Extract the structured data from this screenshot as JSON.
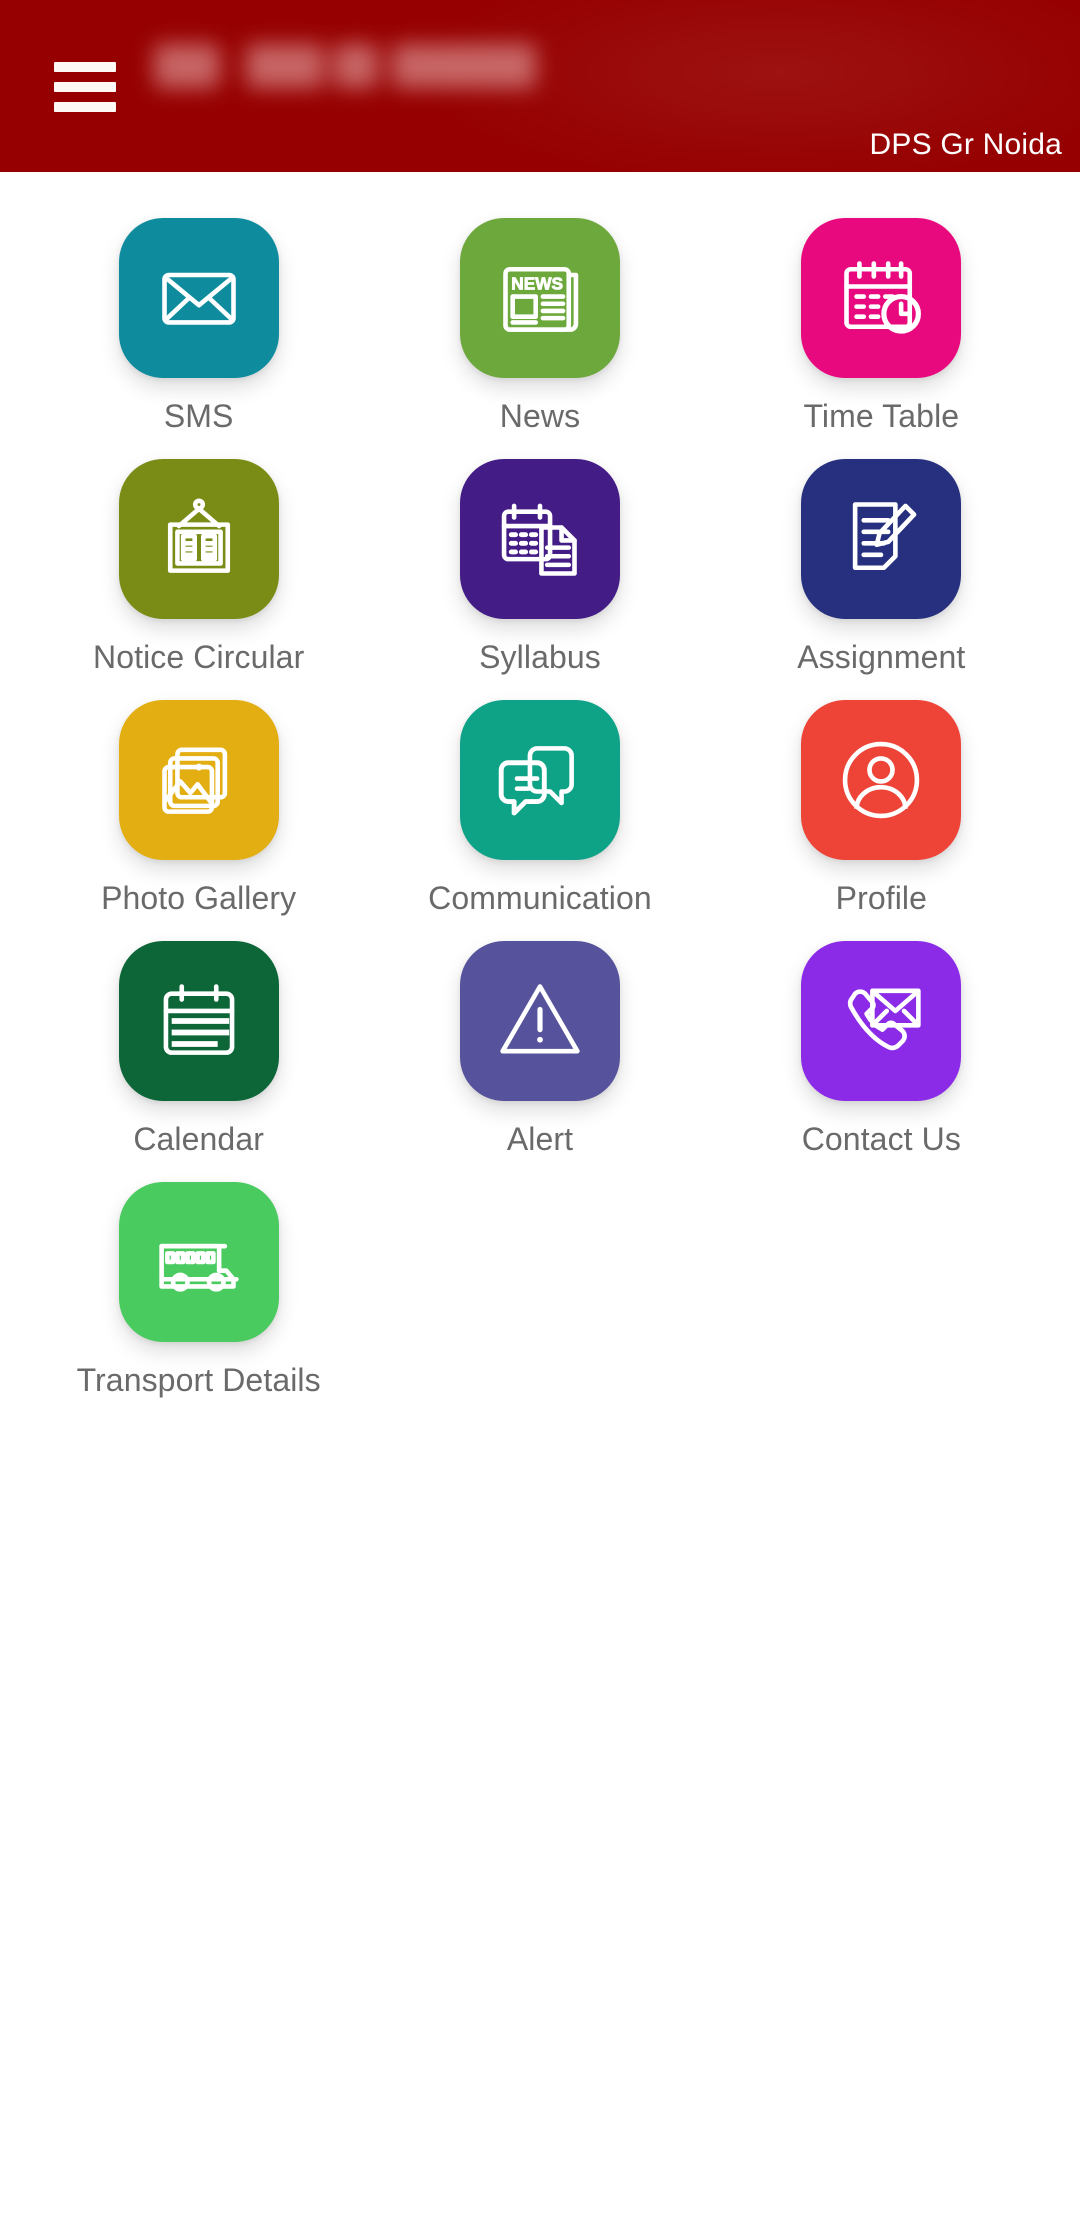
{
  "header": {
    "menu_icon": "hamburger-menu-icon",
    "title_redacted": true,
    "school_name": "DPS Gr Noida",
    "background_color": "#960000",
    "text_color": "#ffffff"
  },
  "grid": {
    "label_color": "#6a6a6a",
    "tiles": [
      {
        "label": "SMS",
        "icon": "envelope-icon",
        "color": "#0E8C9E"
      },
      {
        "label": "News",
        "icon": "newspaper-icon",
        "color": "#6DA83C"
      },
      {
        "label": "Time Table",
        "icon": "calendar-clock-icon",
        "color": "#E8097F"
      },
      {
        "label": "Notice Circular",
        "icon": "notice-board-icon",
        "color": "#7B8C16"
      },
      {
        "label": "Syllabus",
        "icon": "calendar-document-icon",
        "color": "#431C86"
      },
      {
        "label": "Assignment",
        "icon": "document-pencil-icon",
        "color": "#26307F"
      },
      {
        "label": "Photo Gallery",
        "icon": "photo-stack-icon",
        "color": "#E3AE11"
      },
      {
        "label": "Communication",
        "icon": "chat-bubbles-icon",
        "color": "#0EA287"
      },
      {
        "label": "Profile",
        "icon": "user-circle-icon",
        "color": "#EE4438"
      },
      {
        "label": "Calendar",
        "icon": "calendar-icon",
        "color": "#0C6638"
      },
      {
        "label": "Alert",
        "icon": "warning-triangle-icon",
        "color": "#56539C"
      },
      {
        "label": "Contact Us",
        "icon": "phone-envelope-icon",
        "color": "#8B2BE8"
      },
      {
        "label": "Transport Details",
        "icon": "school-bus-icon",
        "color": "#4ACB5F"
      }
    ]
  }
}
